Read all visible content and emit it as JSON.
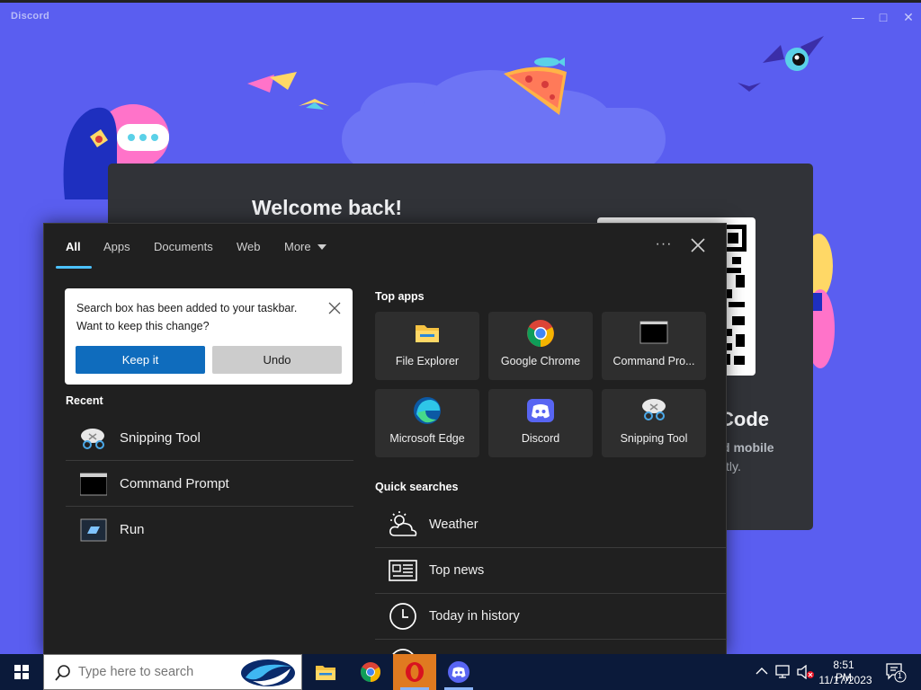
{
  "discord": {
    "window_title": "Discord",
    "welcome_title": "Welcome back!",
    "qr_heading": "Code",
    "qr_desc_line1": "d mobile",
    "qr_desc_line2": "tly."
  },
  "search_panel": {
    "tabs": [
      {
        "label": "All",
        "active": true
      },
      {
        "label": "Apps"
      },
      {
        "label": "Documents"
      },
      {
        "label": "Web"
      },
      {
        "label": "More"
      }
    ],
    "more_options_label": "···",
    "notice": {
      "line1": "Search box has been added to your taskbar.",
      "line2": "Want to keep this change?",
      "keep_label": "Keep it",
      "undo_label": "Undo"
    },
    "recent": {
      "heading": "Recent",
      "items": [
        {
          "label": "Snipping Tool",
          "icon": "snipping-tool-icon"
        },
        {
          "label": "Command Prompt",
          "icon": "command-prompt-icon"
        },
        {
          "label": "Run",
          "icon": "run-icon"
        }
      ]
    },
    "top_apps": {
      "heading": "Top apps",
      "items": [
        {
          "label": "File Explorer",
          "icon": "file-explorer-icon"
        },
        {
          "label": "Google Chrome",
          "icon": "chrome-icon"
        },
        {
          "label": "Command Pro...",
          "icon": "command-prompt-icon"
        },
        {
          "label": "Microsoft Edge",
          "icon": "edge-icon"
        },
        {
          "label": "Discord",
          "icon": "discord-icon"
        },
        {
          "label": "Snipping Tool",
          "icon": "snipping-tool-icon"
        }
      ]
    },
    "quick_searches": {
      "heading": "Quick searches",
      "items": [
        {
          "label": "Weather",
          "icon": "weather-icon"
        },
        {
          "label": "Top news",
          "icon": "news-icon"
        },
        {
          "label": "Today in history",
          "icon": "clock-icon"
        }
      ]
    }
  },
  "taskbar": {
    "search_placeholder": "Type here to search",
    "clock_time": "8:51 PM",
    "clock_date": "11/17/2023",
    "notification_count": "1"
  },
  "colors": {
    "discord_blurple": "#5865f2",
    "panel_bg": "#202020",
    "accent_blue": "#0f6cbd",
    "tab_indicator": "#4cc2ff",
    "taskbar_bg": "#0b1a3a"
  }
}
